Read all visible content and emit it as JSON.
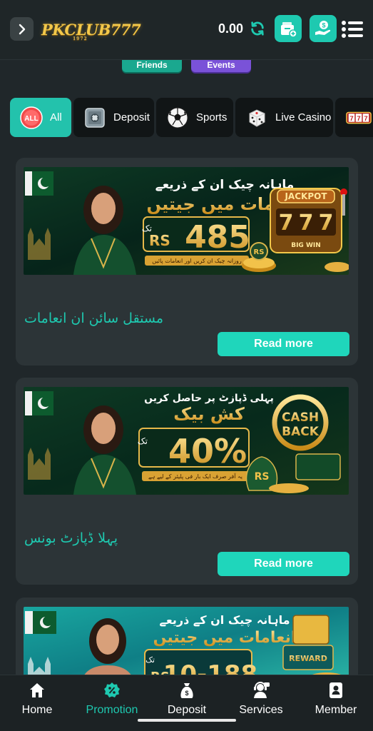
{
  "header": {
    "logo_text": "PKCLUB777",
    "logo_sub": "1972",
    "balance": "0.00",
    "icons": [
      "chevron-right-icon",
      "refresh-icon",
      "wallet-add-icon",
      "hand-money-icon",
      "menu-icon"
    ],
    "accent": "#1ec9b0"
  },
  "top_pills": {
    "friends": "Friends",
    "events": "Events"
  },
  "categories": [
    {
      "label": "All",
      "icon": "all-icon",
      "active": true
    },
    {
      "label": "Deposit",
      "icon": "safe-icon",
      "active": false
    },
    {
      "label": "Sports",
      "icon": "soccer-ball-icon",
      "active": false
    },
    {
      "label": "Live Casino",
      "icon": "dice-icon",
      "active": false
    },
    {
      "label": "",
      "icon": "slot-777-icon",
      "active": false
    }
  ],
  "promos": [
    {
      "banner_line1": "ماہانہ چیک ان کے ذریعے",
      "banner_line2": "انعامات میں جیتیں",
      "banner_prefix": "تک",
      "banner_currency": "RS",
      "banner_amount": "485",
      "banner_footer": "روزانہ چیک ان کریں اور انعامات پائیں",
      "badge_top": "JACKPOT",
      "badge_bottom": "BIG WIN",
      "title": "مستقل سائن ان انعامات",
      "button": "Read more"
    },
    {
      "banner_line1": "پہلی ڈپازٹ پر حاصل کریں",
      "banner_line2": "کش بیک",
      "banner_prefix": "تک",
      "banner_currency": "RS",
      "banner_amount": "40%",
      "banner_footer": "یہ آفر صرف ایک بار فی پلیئر کے لیے ہے",
      "badge_top": "CASH",
      "badge_bottom": "BACK",
      "title": "پہلا ڈپازٹ بونس",
      "button": "Read more"
    },
    {
      "banner_line1": "ماہانہ چیک ان کے ذریعے",
      "banner_line2": "انعامات میں جیتیں",
      "banner_prefix": "تک",
      "banner_currency": "RS",
      "banner_amount": "10-188",
      "badge_top": "REWARD"
    }
  ],
  "bottom_nav": [
    {
      "label": "Home",
      "icon": "home-icon",
      "active": false
    },
    {
      "label": "Promotion",
      "icon": "promotion-icon",
      "active": true
    },
    {
      "label": "Deposit",
      "icon": "money-bag-icon",
      "active": false
    },
    {
      "label": "Services",
      "icon": "support-agent-icon",
      "active": false
    },
    {
      "label": "Member",
      "icon": "member-card-icon",
      "active": false
    }
  ]
}
